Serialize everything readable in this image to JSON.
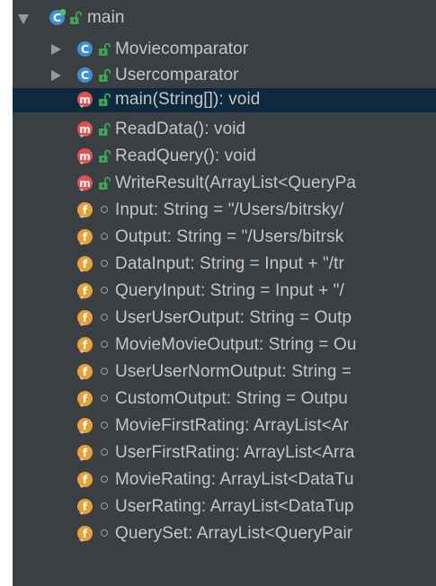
{
  "structure": {
    "root": {
      "label": "main",
      "kind": "class",
      "icon": "class-icon",
      "expanded": true
    },
    "items": [
      {
        "label": "Moviecomparator",
        "kind": "class",
        "icon": "class-icon",
        "visibility": "public",
        "expandable": true
      },
      {
        "label": "Usercomparator",
        "kind": "class",
        "icon": "class-icon",
        "visibility": "public",
        "expandable": true
      },
      {
        "label": "main(String[]): void",
        "kind": "method",
        "icon": "method-icon",
        "visibility": "public",
        "selected": true
      },
      {
        "label": "ReadData(): void",
        "kind": "method",
        "icon": "method-icon",
        "visibility": "public"
      },
      {
        "label": "ReadQuery(): void",
        "kind": "method",
        "icon": "method-icon",
        "visibility": "public"
      },
      {
        "label": "WriteResult(ArrayList<QueryPa",
        "kind": "method",
        "icon": "method-icon",
        "visibility": "public"
      },
      {
        "label": "Input: String = \"/Users/bitrsky/",
        "kind": "field",
        "icon": "field-icon",
        "visibility": "package"
      },
      {
        "label": "Output: String = \"/Users/bitrsk",
        "kind": "field",
        "icon": "field-icon",
        "visibility": "package"
      },
      {
        "label": "DataInput: String = Input + \"/tr",
        "kind": "field",
        "icon": "field-icon",
        "visibility": "package"
      },
      {
        "label": "QueryInput: String = Input + \"/",
        "kind": "field",
        "icon": "field-icon",
        "visibility": "package"
      },
      {
        "label": "UserUserOutput: String = Outp",
        "kind": "field",
        "icon": "field-icon",
        "visibility": "package"
      },
      {
        "label": "MovieMovieOutput: String = Ou",
        "kind": "field",
        "icon": "field-icon",
        "visibility": "package"
      },
      {
        "label": "UserUserNormOutput: String =",
        "kind": "field",
        "icon": "field-icon",
        "visibility": "package"
      },
      {
        "label": "CustomOutput: String = Outpu",
        "kind": "field",
        "icon": "field-icon",
        "visibility": "package"
      },
      {
        "label": "MovieFirstRating: ArrayList<Ar",
        "kind": "field",
        "icon": "field-icon",
        "visibility": "package"
      },
      {
        "label": "UserFirstRating: ArrayList<Arra",
        "kind": "field",
        "icon": "field-icon",
        "visibility": "package"
      },
      {
        "label": "MovieRating: ArrayList<DataTu",
        "kind": "field",
        "icon": "field-icon",
        "visibility": "package"
      },
      {
        "label": "UserRating: ArrayList<DataTup",
        "kind": "field",
        "icon": "field-icon",
        "visibility": "package"
      },
      {
        "label": "QuerySet: ArrayList<QueryPair",
        "kind": "field",
        "icon": "field-icon",
        "visibility": "package"
      }
    ]
  },
  "colors": {
    "panel_bg": "#3c3f41",
    "selection_bg": "#0d293e",
    "class_icon": "#3d8fd6",
    "method_icon": "#e2504f",
    "field_icon": "#e8a13a",
    "lock": "#3ea35a",
    "text": "#c6c6c6"
  }
}
